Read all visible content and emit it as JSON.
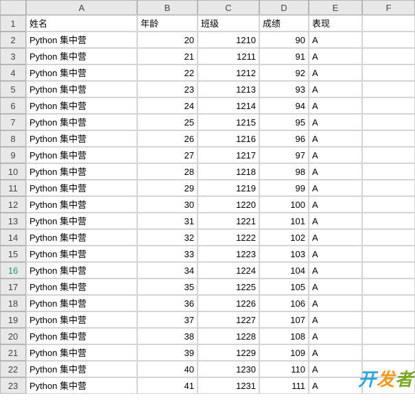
{
  "columns": [
    "A",
    "B",
    "C",
    "D",
    "E",
    "F"
  ],
  "row_numbers": [
    1,
    2,
    3,
    4,
    5,
    6,
    7,
    8,
    9,
    10,
    11,
    12,
    13,
    14,
    15,
    16,
    17,
    18,
    19,
    20,
    21,
    22,
    23
  ],
  "active_row": 16,
  "headers": {
    "A": "姓名",
    "B": "年龄",
    "C": "班级",
    "D": "成绩",
    "E": "表现",
    "F": ""
  },
  "rows": [
    {
      "name": "Python 集中营",
      "age": 20,
      "class": 1210,
      "score": 90,
      "grade": "A"
    },
    {
      "name": "Python 集中营",
      "age": 21,
      "class": 1211,
      "score": 91,
      "grade": "A"
    },
    {
      "name": "Python 集中营",
      "age": 22,
      "class": 1212,
      "score": 92,
      "grade": "A"
    },
    {
      "name": "Python 集中营",
      "age": 23,
      "class": 1213,
      "score": 93,
      "grade": "A"
    },
    {
      "name": "Python 集中营",
      "age": 24,
      "class": 1214,
      "score": 94,
      "grade": "A"
    },
    {
      "name": "Python 集中营",
      "age": 25,
      "class": 1215,
      "score": 95,
      "grade": "A"
    },
    {
      "name": "Python 集中营",
      "age": 26,
      "class": 1216,
      "score": 96,
      "grade": "A"
    },
    {
      "name": "Python 集中营",
      "age": 27,
      "class": 1217,
      "score": 97,
      "grade": "A"
    },
    {
      "name": "Python 集中营",
      "age": 28,
      "class": 1218,
      "score": 98,
      "grade": "A"
    },
    {
      "name": "Python 集中营",
      "age": 29,
      "class": 1219,
      "score": 99,
      "grade": "A"
    },
    {
      "name": "Python 集中营",
      "age": 30,
      "class": 1220,
      "score": 100,
      "grade": "A"
    },
    {
      "name": "Python 集中营",
      "age": 31,
      "class": 1221,
      "score": 101,
      "grade": "A"
    },
    {
      "name": "Python 集中营",
      "age": 32,
      "class": 1222,
      "score": 102,
      "grade": "A"
    },
    {
      "name": "Python 集中营",
      "age": 33,
      "class": 1223,
      "score": 103,
      "grade": "A"
    },
    {
      "name": "Python 集中营",
      "age": 34,
      "class": 1224,
      "score": 104,
      "grade": "A"
    },
    {
      "name": "Python 集中营",
      "age": 35,
      "class": 1225,
      "score": 105,
      "grade": "A"
    },
    {
      "name": "Python 集中营",
      "age": 36,
      "class": 1226,
      "score": 106,
      "grade": "A"
    },
    {
      "name": "Python 集中营",
      "age": 37,
      "class": 1227,
      "score": 107,
      "grade": "A"
    },
    {
      "name": "Python 集中营",
      "age": 38,
      "class": 1228,
      "score": 108,
      "grade": "A"
    },
    {
      "name": "Python 集中营",
      "age": 39,
      "class": 1229,
      "score": 109,
      "grade": "A"
    },
    {
      "name": "Python 集中营",
      "age": 40,
      "class": 1230,
      "score": 110,
      "grade": "A"
    },
    {
      "name": "Python 集中营",
      "age": 41,
      "class": 1231,
      "score": 111,
      "grade": "A"
    }
  ],
  "watermark": {
    "t1": "开",
    "t2": "发",
    "t3": "者"
  }
}
